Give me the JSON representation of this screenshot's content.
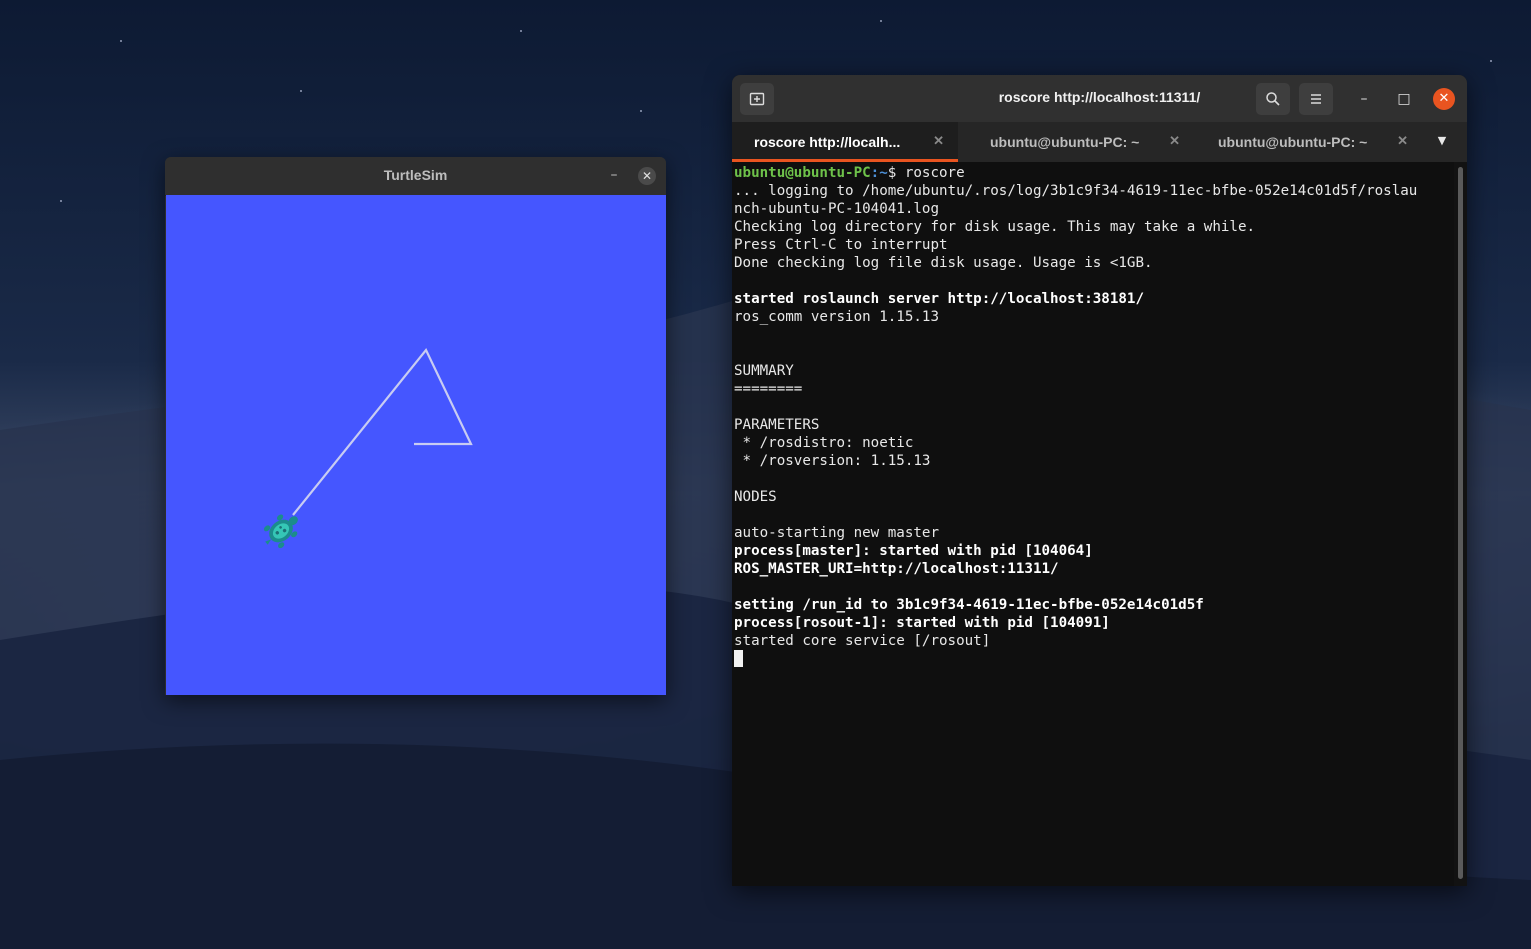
{
  "turtlesim": {
    "title": "TurtleSim",
    "minimize_glyph": "–",
    "close_glyph": "✕",
    "background_color": "#4556ff",
    "turtle_icon": "turtle-icon"
  },
  "terminal": {
    "title": "roscore http://localhost:11311/",
    "new_tab_icon": "new-tab-icon",
    "search_icon": "search-icon",
    "menu_icon": "hamburger-menu-icon",
    "minimize_glyph": "–",
    "maximize_glyph": "□",
    "close_glyph": "✕",
    "tabs": [
      {
        "label": "roscore http://localh...",
        "active": true
      },
      {
        "label": "ubuntu@ubuntu-PC: ~",
        "active": false
      },
      {
        "label": "ubuntu@ubuntu-PC: ~",
        "active": false
      }
    ],
    "tab_close_glyph": "✕",
    "tab_menu_glyph": "▼",
    "prompt": {
      "user": "ubuntu@ubuntu-PC",
      "path": ":~",
      "symbol": "$",
      "command": " roscore"
    },
    "lines": [
      {
        "text": "... logging to /home/ubuntu/.ros/log/3b1c9f34-4619-11ec-bfbe-052e14c01d5f/roslau",
        "bold": false
      },
      {
        "text": "nch-ubuntu-PC-104041.log",
        "bold": false
      },
      {
        "text": "Checking log directory for disk usage. This may take a while.",
        "bold": false
      },
      {
        "text": "Press Ctrl-C to interrupt",
        "bold": false
      },
      {
        "text": "Done checking log file disk usage. Usage is <1GB.",
        "bold": false
      },
      {
        "text": "",
        "bold": false
      },
      {
        "text": "started roslaunch server http://localhost:38181/",
        "bold": true
      },
      {
        "text": "ros_comm version 1.15.13",
        "bold": false
      },
      {
        "text": "",
        "bold": false
      },
      {
        "text": "",
        "bold": false
      },
      {
        "text": "SUMMARY",
        "bold": false
      },
      {
        "text": "========",
        "bold": false
      },
      {
        "text": "",
        "bold": false
      },
      {
        "text": "PARAMETERS",
        "bold": false
      },
      {
        "text": " * /rosdistro: noetic",
        "bold": false
      },
      {
        "text": " * /rosversion: 1.15.13",
        "bold": false
      },
      {
        "text": "",
        "bold": false
      },
      {
        "text": "NODES",
        "bold": false
      },
      {
        "text": "",
        "bold": false
      },
      {
        "text": "auto-starting new master",
        "bold": false
      },
      {
        "text": "process[master]: started with pid [104064]",
        "bold": true
      },
      {
        "text": "ROS_MASTER_URI=http://localhost:11311/",
        "bold": true
      },
      {
        "text": "",
        "bold": false
      },
      {
        "text": "setting /run_id to 3b1c9f34-4619-11ec-bfbe-052e14c01d5f",
        "bold": true
      },
      {
        "text": "process[rosout-1]: started with pid [104091]",
        "bold": true
      },
      {
        "text": "started core service [/rosout]",
        "bold": false
      }
    ]
  }
}
